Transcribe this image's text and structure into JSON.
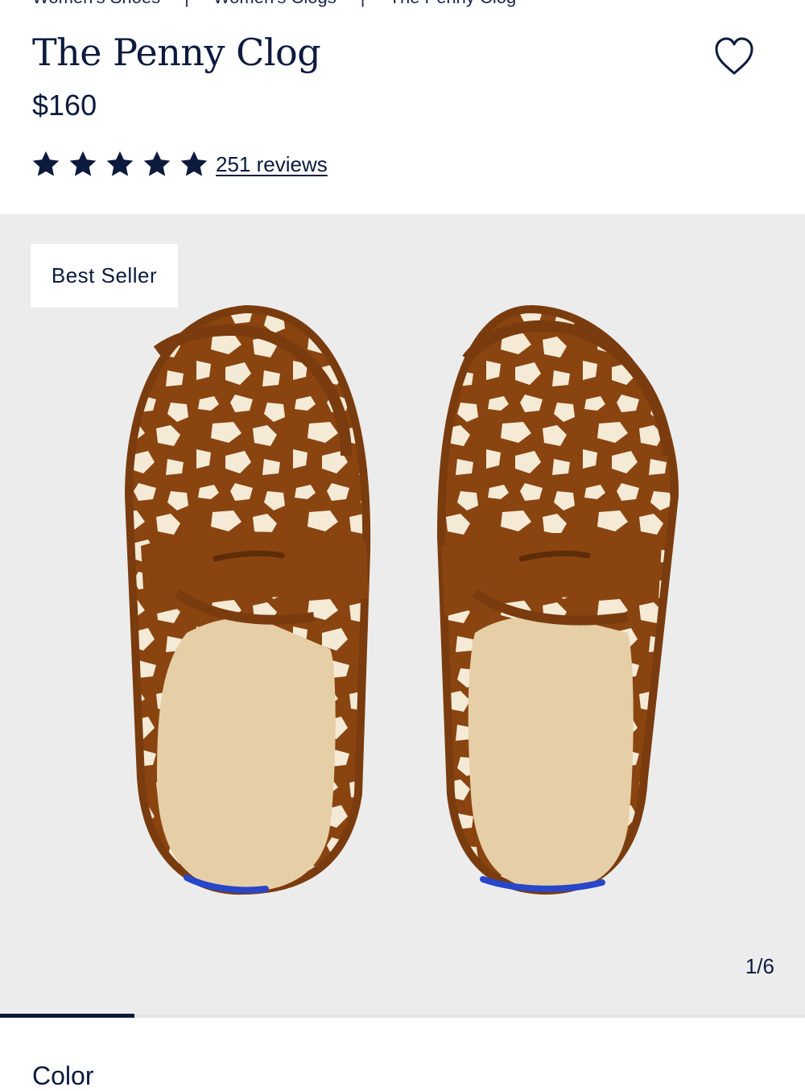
{
  "breadcrumb": {
    "items": [
      "Women's Shoes",
      "Women's Clogs",
      "The Penny Clog"
    ],
    "separator": "|"
  },
  "product": {
    "title": "The Penny Clog",
    "price": "$160",
    "rating": 5,
    "rating_max": 5,
    "reviews_label": "251 reviews"
  },
  "gallery": {
    "badge": "Best Seller",
    "counter": "1/6",
    "current_index": 1,
    "total": 6,
    "progress_fraction": 0.1667
  },
  "next_section": {
    "heading": "Color"
  },
  "icons": {
    "favorite": "heart-outline-icon",
    "rating": "star-icon"
  },
  "colors": {
    "brand_navy": "#0c1a3e",
    "gallery_bg": "#ececec",
    "shoe_brown": "#8a4410",
    "shoe_cream": "#f4ead6",
    "footbed": "#e6cfa7",
    "heel_stripe": "#2846c9"
  }
}
